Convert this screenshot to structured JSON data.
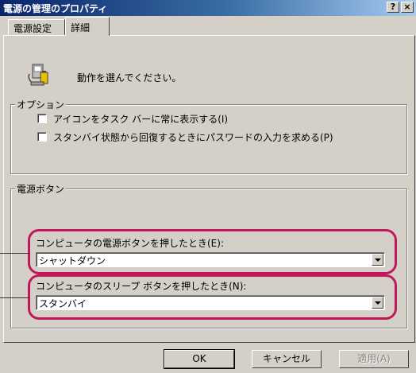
{
  "window": {
    "title": "電源の管理のプロパティ",
    "help_button": "?",
    "close_button": "×"
  },
  "tabs": [
    {
      "label": "電源設定"
    },
    {
      "label": "詳細"
    }
  ],
  "intro": {
    "icon": "battery-computer-icon",
    "text": "動作を選んでください。"
  },
  "options_group": {
    "legend": "オプション",
    "checkboxes": [
      {
        "label": "アイコンをタスク バーに常に表示する(I)",
        "checked": false
      },
      {
        "label": "スタンバイ状態から回復するときにパスワードの入力を求める(P)",
        "checked": false
      }
    ]
  },
  "power_buttons_group": {
    "legend": "電源ボタン",
    "power_button_label": "コンピュータの電源ボタンを押したとき(E):",
    "power_button_value": "シャットダウン",
    "sleep_button_label": "コンピュータのスリープ ボタンを押したとき(N):",
    "sleep_button_value": "スタンバイ"
  },
  "footer": {
    "ok": "OK",
    "cancel": "キャンセル",
    "apply": "適用(A)"
  },
  "colors": {
    "highlight": "#c2185b",
    "titlebar": "#0a246a"
  }
}
